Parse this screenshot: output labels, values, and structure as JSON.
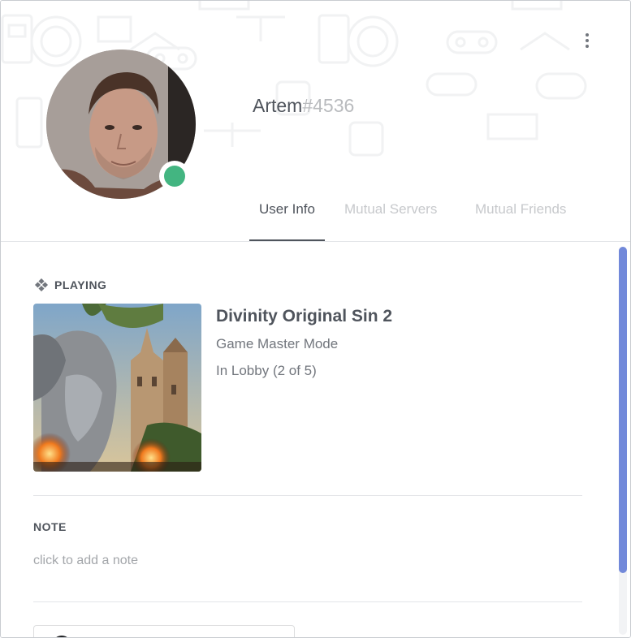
{
  "profile": {
    "username": "Artem",
    "discriminator": "#4536",
    "status": "online",
    "status_color": "#43b581"
  },
  "tabs": [
    {
      "label": "User Info",
      "active": true
    },
    {
      "label": "Mutual Servers",
      "active": false
    },
    {
      "label": "Mutual Friends",
      "active": false
    }
  ],
  "activity": {
    "label": "PLAYING",
    "icon": "gamepad-icon",
    "game_title": "Divinity Original Sin 2",
    "details": "Game Master Mode",
    "state": "In Lobby (2 of 5)"
  },
  "note": {
    "label": "NOTE",
    "placeholder": "click to add a note"
  },
  "colors": {
    "accent": "#7289da",
    "text_primary": "#4f545c",
    "text_muted": "#72767d"
  }
}
